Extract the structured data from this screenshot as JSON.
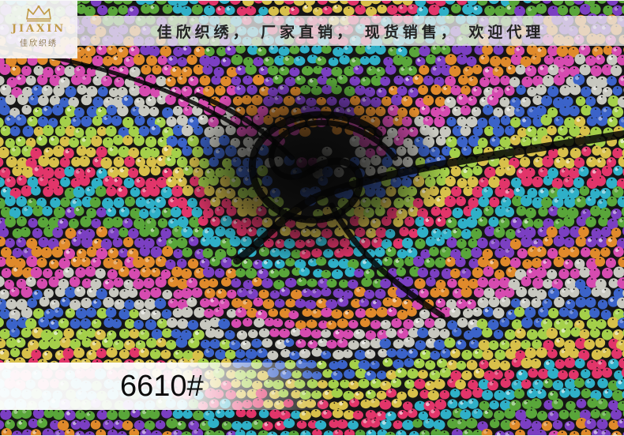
{
  "logo": {
    "brand_en": "JIAXIN",
    "brand_cn": "佳欣织绣",
    "icon": "crown-icon"
  },
  "banner": {
    "slogan": "佳欣织绣， 厂家直销， 现货销售， 欢迎代理"
  },
  "product": {
    "code": "6610#"
  },
  "colors": {
    "logo_gold": "#c09a47",
    "fabric_base": "#151515",
    "sequin_palette": [
      "#d8c04a",
      "#e2356a",
      "#2fb0c8",
      "#59a63a",
      "#7b3fc2",
      "#e08a2b",
      "#d64bb0",
      "#c8c8c0",
      "#3b63c9",
      "#a4d04a"
    ]
  }
}
